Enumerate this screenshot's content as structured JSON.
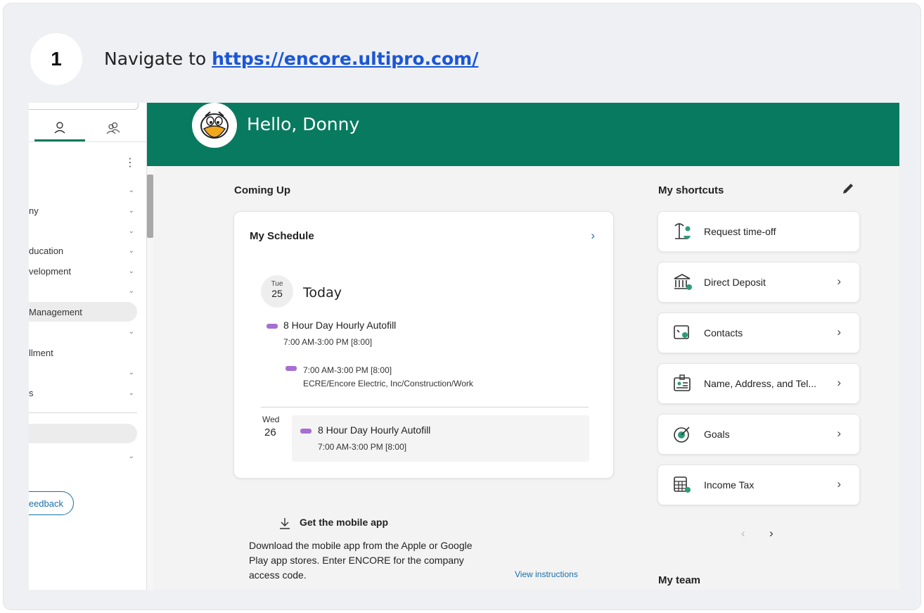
{
  "step": {
    "number": "1",
    "text_prefix": "Navigate to ",
    "link": "https://encore.ultipro.com/"
  },
  "sidebar": {
    "items": [
      {
        "label": "",
        "chevron": true
      },
      {
        "label": "ny",
        "chevron": true
      },
      {
        "label": "",
        "chevron": true
      },
      {
        "label": "ducation",
        "chevron": true
      },
      {
        "label": "velopment",
        "chevron": true
      },
      {
        "label": "",
        "chevron": true
      },
      {
        "label": "Management",
        "chevron": false
      },
      {
        "label": "",
        "chevron": true
      },
      {
        "label": "llment",
        "chevron": false
      },
      {
        "label": "",
        "chevron": true
      },
      {
        "label": "s",
        "chevron": true
      },
      {
        "label": "",
        "chevron": true
      }
    ],
    "feedback_label": "eedback"
  },
  "header": {
    "greeting": "Hello, Donny"
  },
  "coming_up": {
    "title": "Coming Up",
    "schedule": {
      "title": "My Schedule",
      "today": {
        "dow": "Tue",
        "day": "25",
        "label": "Today",
        "event_title": "8 Hour Day Hourly Autofill",
        "event_time": "7:00 AM-3:00 PM [8:00]",
        "sub_time": "7:00 AM-3:00 PM [8:00]",
        "sub_location": "ECRE/Encore Electric, Inc/Construction/Work"
      },
      "next": {
        "dow": "Wed",
        "day": "26",
        "event_title": "8 Hour Day Hourly Autofill",
        "event_time": "7:00 AM-3:00 PM [8:00]"
      }
    }
  },
  "mobile_app": {
    "title": "Get the mobile app",
    "text": "Download the mobile app from the Apple or Google Play app stores. Enter ENCORE for the company access code.",
    "link": "View instructions"
  },
  "shortcuts": {
    "title": "My shortcuts",
    "items": [
      {
        "label": "Request time-off",
        "icon": "beach-icon",
        "chevron": false
      },
      {
        "label": "Direct Deposit",
        "icon": "bank-icon",
        "chevron": true
      },
      {
        "label": "Contacts",
        "icon": "contacts-icon",
        "chevron": true
      },
      {
        "label": "Name, Address, and Tel...",
        "icon": "id-card-icon",
        "chevron": true
      },
      {
        "label": "Goals",
        "icon": "target-icon",
        "chevron": true
      },
      {
        "label": "Income Tax",
        "icon": "calculator-icon",
        "chevron": true
      }
    ]
  },
  "my_team": {
    "title": "My team"
  },
  "colors": {
    "header_green": "#087a5f",
    "event_purple": "#a66fd1",
    "link_blue": "#1a6fa8"
  }
}
